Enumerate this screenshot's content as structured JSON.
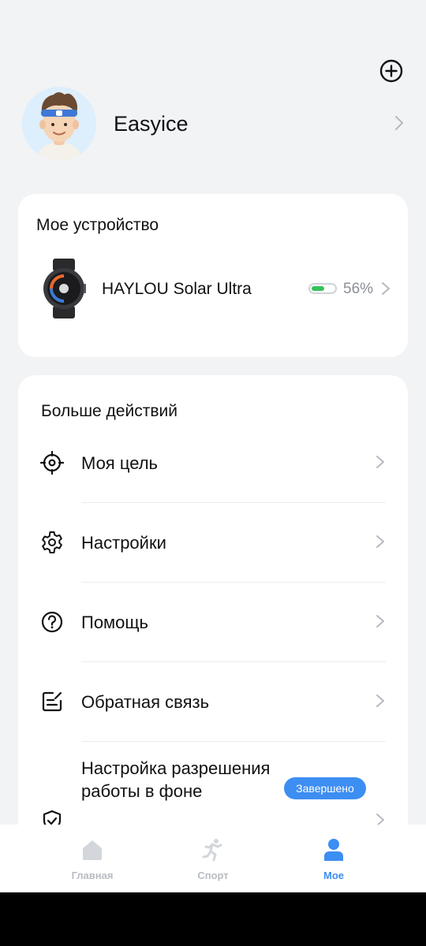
{
  "profile": {
    "username": "Easyice"
  },
  "device_card": {
    "title": "Мое устройство",
    "device_name": "HAYLOU Solar Ultra",
    "battery_percent": "56%",
    "battery_level": 0.56,
    "battery_color": "#36c25b"
  },
  "actions": {
    "title": "Больше действий",
    "items": [
      {
        "label": "Моя цель",
        "icon": "target-icon"
      },
      {
        "label": "Настройки",
        "icon": "gear-icon"
      },
      {
        "label": "Помощь",
        "icon": "help-icon"
      },
      {
        "label": "Обратная связь",
        "icon": "feedback-icon"
      },
      {
        "label": "Настройка разрешения работы в фоне",
        "icon": "shield-check-icon"
      }
    ],
    "badge": "Завершено"
  },
  "tabs": [
    {
      "label": "Главная",
      "icon": "home-icon",
      "active": false
    },
    {
      "label": "Спорт",
      "icon": "run-icon",
      "active": false
    },
    {
      "label": "Мое",
      "icon": "person-icon",
      "active": true
    }
  ],
  "colors": {
    "accent": "#3d8ef2",
    "background": "#f2f3f5"
  }
}
